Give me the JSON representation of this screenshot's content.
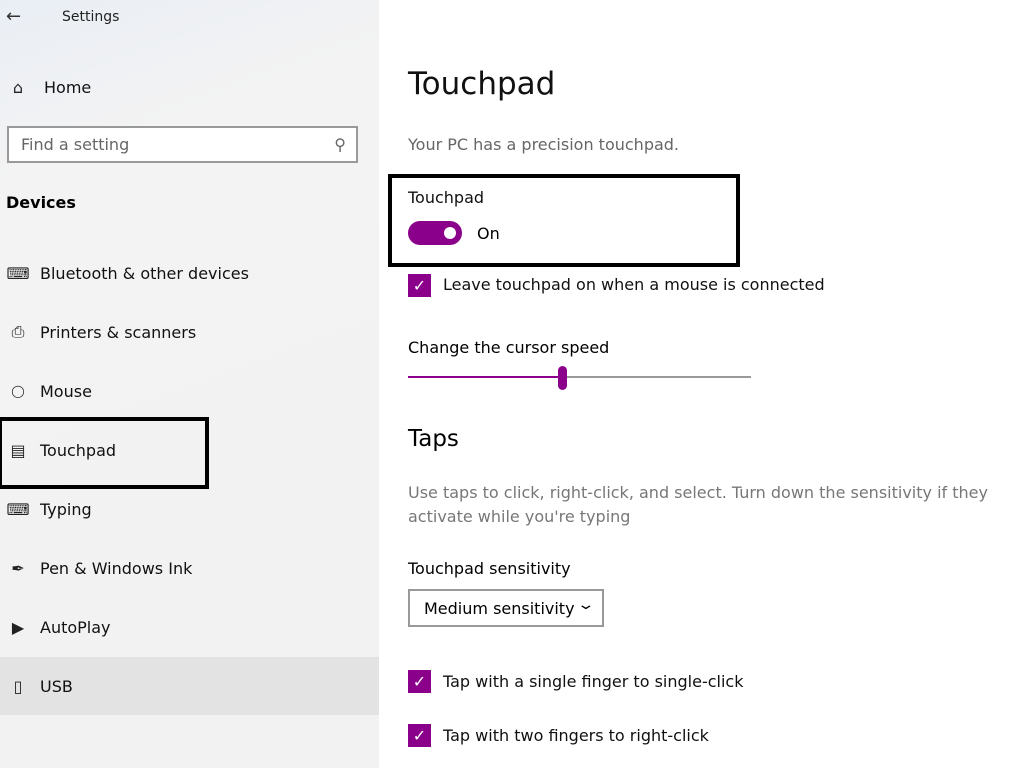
{
  "window": {
    "title": "Settings",
    "back_icon": "arrow-left-icon"
  },
  "sidebar": {
    "home": "Home",
    "search_placeholder": "Find a setting",
    "section": "Devices",
    "items": [
      {
        "label": "Bluetooth & other devices",
        "icon": "bluetooth-devices-icon"
      },
      {
        "label": "Printers & scanners",
        "icon": "printer-icon"
      },
      {
        "label": "Mouse",
        "icon": "mouse-icon"
      },
      {
        "label": "Touchpad",
        "icon": "touchpad-icon",
        "selected": true
      },
      {
        "label": "Typing",
        "icon": "keyboard-icon"
      },
      {
        "label": "Pen & Windows Ink",
        "icon": "pen-icon"
      },
      {
        "label": "AutoPlay",
        "icon": "autoplay-icon"
      },
      {
        "label": "USB",
        "icon": "usb-icon",
        "hovered": true
      }
    ]
  },
  "main": {
    "title": "Touchpad",
    "subtitle": "Your PC has a precision touchpad.",
    "toggle_label": "Touchpad",
    "toggle_state": "On",
    "toggle_on": true,
    "leave_on_label": "Leave touchpad on when a mouse is connected",
    "leave_on_checked": true,
    "cursor_speed_label": "Change the cursor speed",
    "cursor_speed_percent": 45,
    "taps_heading": "Taps",
    "taps_desc_1": "Use taps to click, right-click, and select. Turn down the sensitivity if they",
    "taps_desc_2": "activate while you're typing",
    "sensitivity_label": "Touchpad sensitivity",
    "sensitivity_value": "Medium sensitivity",
    "tap_single": "Tap with a single finger to single-click",
    "tap_single_checked": true,
    "tap_two": "Tap with two fingers to right-click",
    "tap_two_checked": true
  },
  "colors": {
    "accent": "#8b008b",
    "highlight_border": "#000000"
  }
}
